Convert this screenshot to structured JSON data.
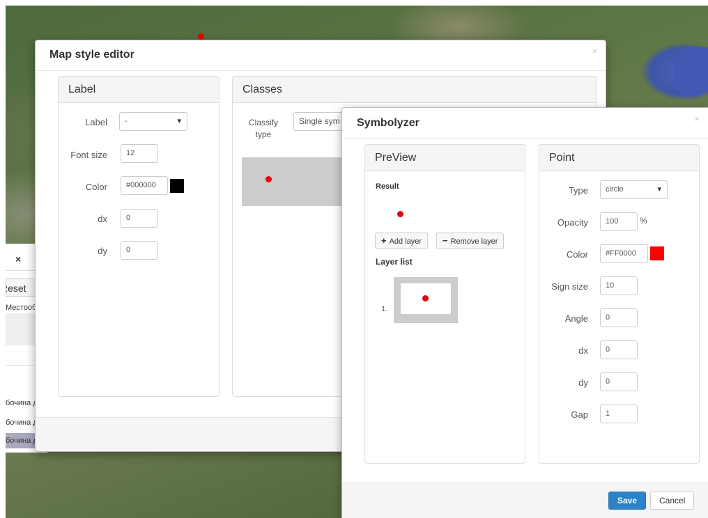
{
  "background": {
    "side_panel": {
      "reset_label": "Reset",
      "text_line": "Местооб",
      "rows": [
        "бочина д",
        "бочина д",
        "бочина д"
      ]
    }
  },
  "map_style_editor": {
    "title": "Map style editor",
    "label_panel": {
      "heading": "Label",
      "fields": {
        "label": {
          "label": "Label",
          "value": "-"
        },
        "font_size": {
          "label": "Font size",
          "value": "12"
        },
        "color": {
          "label": "Color",
          "value": "#000000",
          "swatch": "#000000"
        },
        "dx": {
          "label": "dx",
          "value": "0"
        },
        "dy": {
          "label": "dy",
          "value": "0"
        }
      }
    },
    "classes_panel": {
      "heading": "Classes",
      "classify_type_label": "Classify type",
      "classify_type_value": "Single sym",
      "preview_color": "#cccccc",
      "point_color": "#e8000b"
    }
  },
  "symbolyzer": {
    "title": "Symbolyzer",
    "preview": {
      "heading": "PreView",
      "result_label": "Result",
      "add_layer_label": "Add layer",
      "remove_layer_label": "Remove layer",
      "layer_list_label": "Layer list",
      "layers": [
        {
          "index": "1."
        }
      ]
    },
    "point": {
      "heading": "Point",
      "fields": {
        "type": {
          "label": "Type",
          "value": "circle"
        },
        "opacity": {
          "label": "Opacity",
          "value": "100",
          "unit": "%"
        },
        "color": {
          "label": "Color",
          "value": "#FF0000",
          "swatch": "#FF0000"
        },
        "sign_size": {
          "label": "Sign size",
          "value": "10"
        },
        "angle": {
          "label": "Angle",
          "value": "0"
        },
        "dx": {
          "label": "dx",
          "value": "0"
        },
        "dy": {
          "label": "dy",
          "value": "0"
        },
        "gap": {
          "label": "Gap",
          "value": "1"
        }
      }
    },
    "save_label": "Save",
    "cancel_label": "Cancel"
  },
  "colors": {
    "accent": "#2d83c8",
    "point": "#e8000b"
  }
}
